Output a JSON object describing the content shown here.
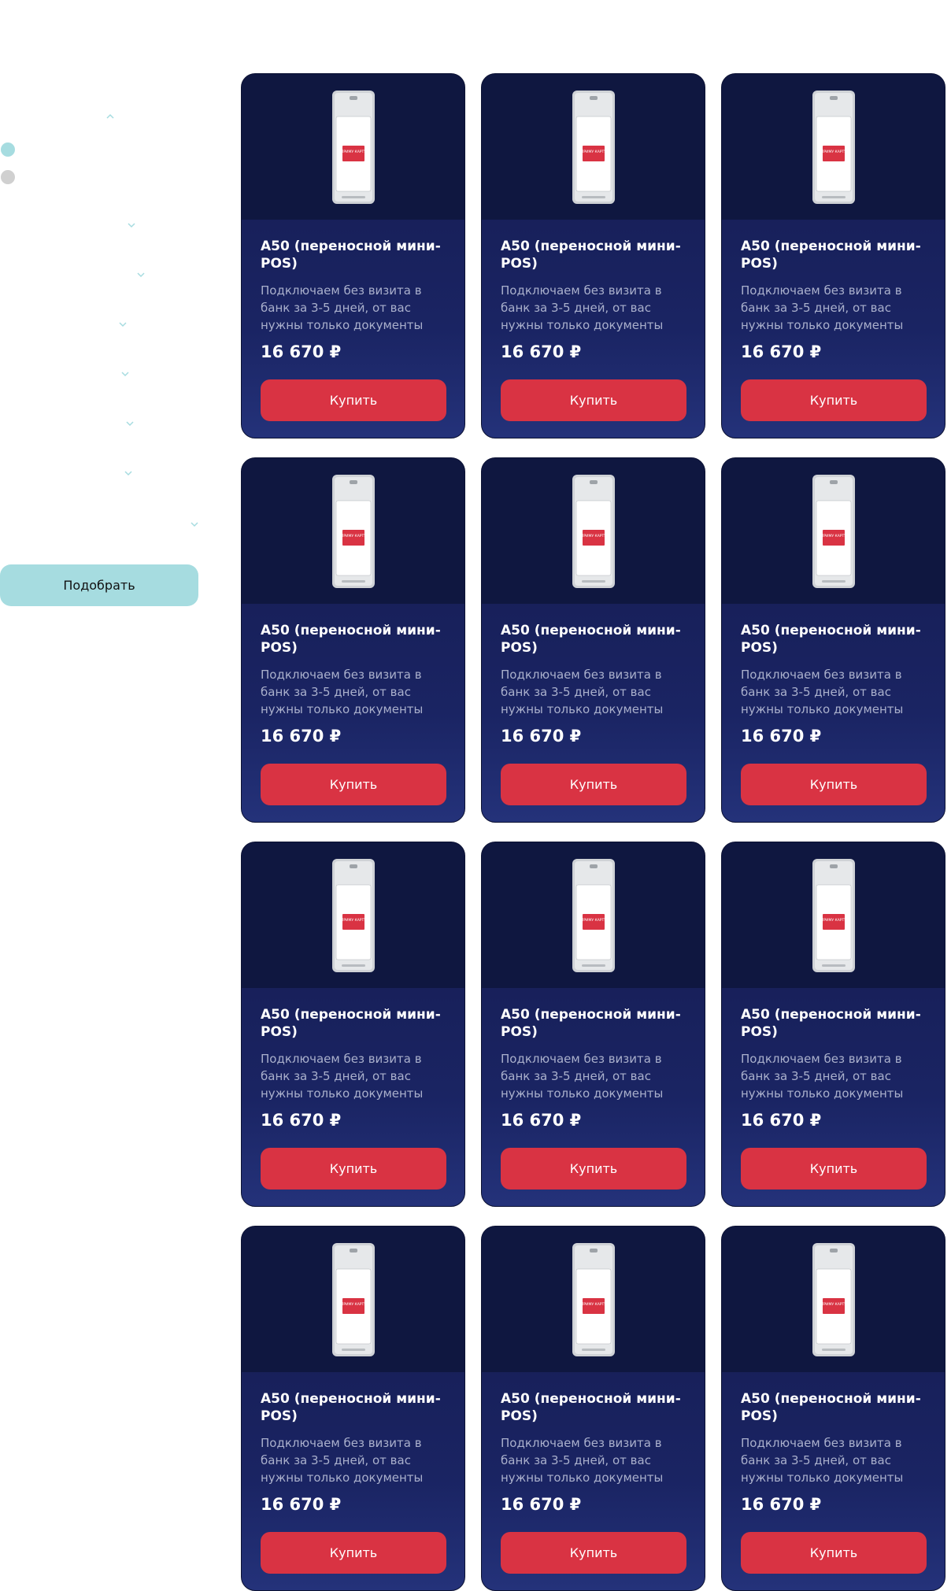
{
  "sidebar": {
    "pick_button_label": "Подобрать",
    "colors": {
      "accent": "#a6dce0",
      "dot_active": "#a6dce0",
      "dot_inactive": "#d0d0d0"
    }
  },
  "products": [
    {
      "title": "A50 (переносной мини-POS)",
      "description": "Подключаем без визита в банк за 3-5 дней, от вас нужны только документы",
      "price": "16 670 ₽",
      "buy_label": "Купить",
      "screen_label": "ПРИМУ КАРТУ"
    },
    {
      "title": "A50 (переносной мини-POS)",
      "description": "Подключаем без визита в банк за 3-5 дней, от вас нужны только документы",
      "price": "16 670 ₽",
      "buy_label": "Купить",
      "screen_label": "ПРИМУ КАРТУ"
    },
    {
      "title": "A50 (переносной мини-POS)",
      "description": "Подключаем без визита в банк за 3-5 дней, от вас нужны только документы",
      "price": "16 670 ₽",
      "buy_label": "Купить",
      "screen_label": "ПРИМУ КАРТУ"
    },
    {
      "title": "A50 (переносной мини-POS)",
      "description": "Подключаем без визита в банк за 3-5 дней, от вас нужны только документы",
      "price": "16 670 ₽",
      "buy_label": "Купить",
      "screen_label": "ПРИМУ КАРТУ"
    },
    {
      "title": "A50 (переносной мини-POS)",
      "description": "Подключаем без визита в банк за 3-5 дней, от вас нужны только документы",
      "price": "16 670 ₽",
      "buy_label": "Купить",
      "screen_label": "ПРИМУ КАРТУ"
    },
    {
      "title": "A50 (переносной мини-POS)",
      "description": "Подключаем без визита в банк за 3-5 дней, от вас нужны только документы",
      "price": "16 670 ₽",
      "buy_label": "Купить",
      "screen_label": "ПРИМУ КАРТУ"
    },
    {
      "title": "A50 (переносной мини-POS)",
      "description": "Подключаем без визита в банк за 3-5 дней, от вас нужны только документы",
      "price": "16 670 ₽",
      "buy_label": "Купить",
      "screen_label": "ПРИМУ КАРТУ"
    },
    {
      "title": "A50 (переносной мини-POS)",
      "description": "Подключаем без визита в банк за 3-5 дней, от вас нужны только документы",
      "price": "16 670 ₽",
      "buy_label": "Купить",
      "screen_label": "ПРИМУ КАРТУ"
    },
    {
      "title": "A50 (переносной мини-POS)",
      "description": "Подключаем без визита в банк за 3-5 дней, от вас нужны только документы",
      "price": "16 670 ₽",
      "buy_label": "Купить",
      "screen_label": "ПРИМУ КАРТУ"
    },
    {
      "title": "A50 (переносной мини-POS)",
      "description": "Подключаем без визита в банк за 3-5 дней, от вас нужны только документы",
      "price": "16 670 ₽",
      "buy_label": "Купить",
      "screen_label": "ПРИМУ КАРТУ"
    },
    {
      "title": "A50 (переносной мини-POS)",
      "description": "Подключаем без визита в банк за 3-5 дней, от вас нужны только документы",
      "price": "16 670 ₽",
      "buy_label": "Купить",
      "screen_label": "ПРИМУ КАРТУ"
    },
    {
      "title": "A50 (переносной мини-POS)",
      "description": "Подключаем без визита в банк за 3-5 дней, от вас нужны только документы",
      "price": "16 670 ₽",
      "buy_label": "Купить",
      "screen_label": "ПРИМУ КАРТУ"
    }
  ],
  "colors": {
    "card_bg": "#151b4f",
    "card_image_bg": "#0f1740",
    "buy_button": "#d93343",
    "description_text": "#aab0cc"
  }
}
